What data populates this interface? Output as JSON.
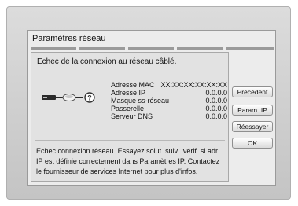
{
  "dialog": {
    "title": "Paramètres réseau",
    "message_top": "Echec de la connexion au réseau câblé.",
    "message_bottom": "Echec connexion réseau. Essayez solut. suiv. :vérif. si adr. IP est définie correctement dans Paramètres IP. Contactez le fournisseur de services Internet pour plus d'infos."
  },
  "network_info": [
    {
      "label": "Adresse MAC",
      "value": "XX:XX:XX:XX:XX:XX"
    },
    {
      "label": "Adresse IP",
      "value": "0.0.0.0"
    },
    {
      "label": "Masque ss-réseau",
      "value": "0.0.0.0"
    },
    {
      "label": "Passerelle",
      "value": "0.0.0.0"
    },
    {
      "label": "Serveur DNS",
      "value": "0.0.0.0"
    }
  ],
  "diagram": {
    "icons": [
      "player-icon",
      "cable-icon",
      "router-icon",
      "question-icon"
    ],
    "status_glyph": "?"
  },
  "buttons": {
    "previous": "Précédent",
    "ip_settings": "Param. IP",
    "retry": "Réessayer",
    "ok": "OK"
  }
}
